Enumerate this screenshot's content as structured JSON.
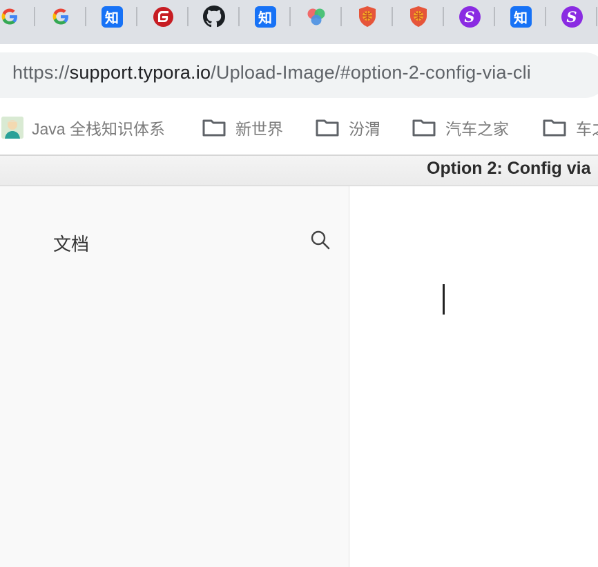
{
  "browser": {
    "tabs": [
      {
        "icon": "google-icon"
      },
      {
        "icon": "google-icon"
      },
      {
        "icon": "zhihu-icon",
        "glyph": "知"
      },
      {
        "icon": "gitee-icon"
      },
      {
        "icon": "github-icon"
      },
      {
        "icon": "zhihu-icon",
        "glyph": "知"
      },
      {
        "icon": "colorful-dots-icon"
      },
      {
        "icon": "shield-ball-icon"
      },
      {
        "icon": "shield-ball-icon"
      },
      {
        "icon": "purple-s-icon",
        "glyph": "S"
      },
      {
        "icon": "zhihu-icon",
        "glyph": "知"
      },
      {
        "icon": "purple-s-icon",
        "glyph": "S"
      }
    ],
    "address": {
      "scheme": "https://",
      "host": "support.typora.io",
      "path": "/Upload-Image/#option-2-config-via-cli"
    },
    "bookmarks": [
      {
        "label": "Java 全栈知识体系",
        "icon": "avatar-icon"
      },
      {
        "label": "新世界",
        "icon": "folder-icon"
      },
      {
        "label": "汾渭",
        "icon": "folder-icon"
      },
      {
        "label": "汽车之家",
        "icon": "folder-icon"
      },
      {
        "label": "车之",
        "icon": "folder-icon"
      }
    ]
  },
  "page": {
    "title": "Option 2: Config via",
    "sidebar": {
      "title": "文档",
      "search_icon": "search-icon"
    }
  },
  "colors": {
    "zhihu": "#1772f6",
    "gitee": "#c71d23",
    "purple_s": "#8a2be2",
    "shield": "#e6553a"
  }
}
